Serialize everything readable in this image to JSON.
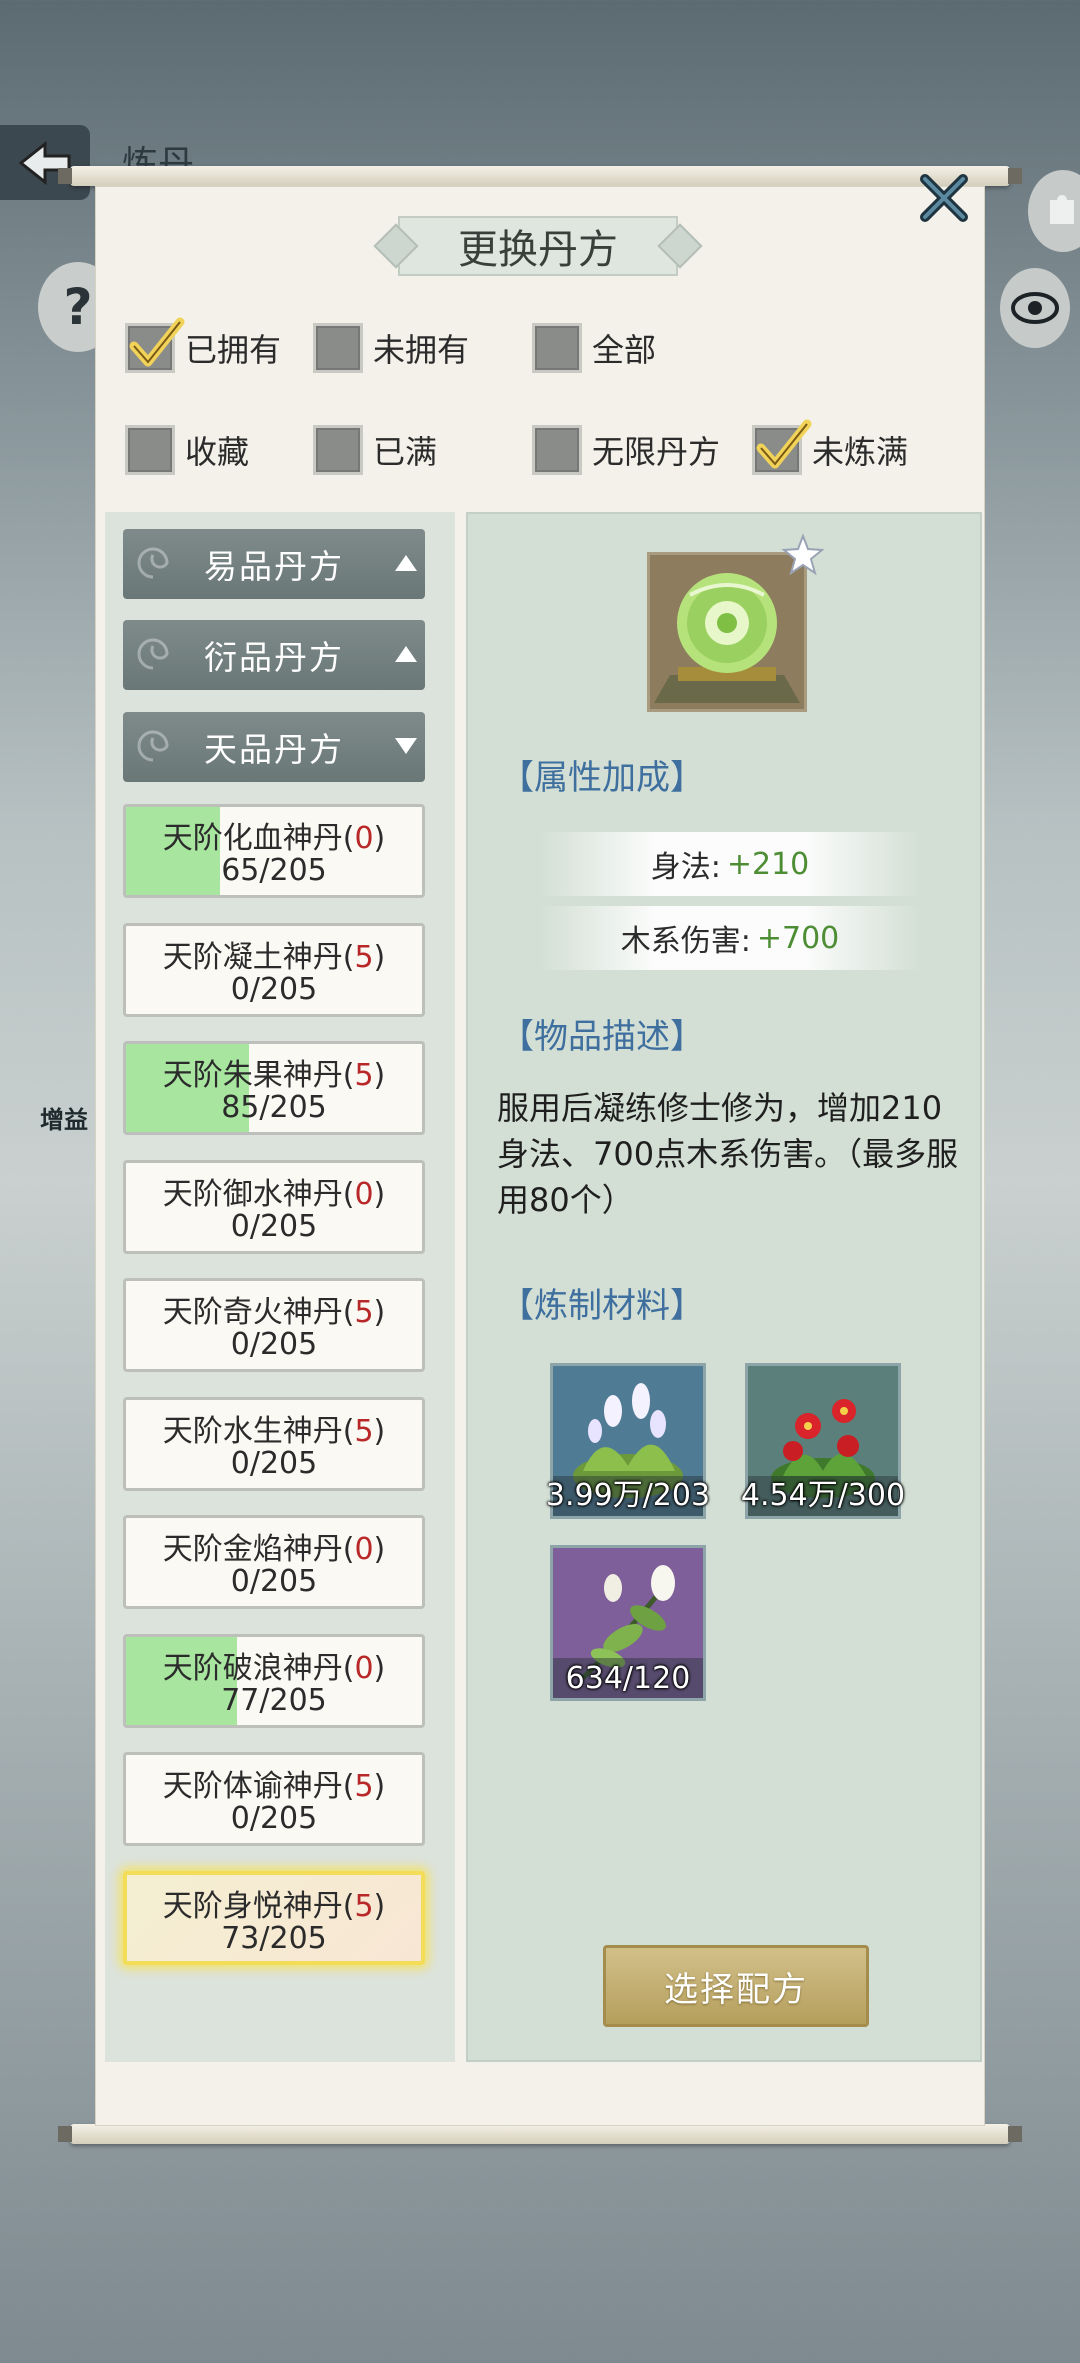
{
  "background": {
    "page_title": "炼丹",
    "side_badge": "增益"
  },
  "dialog": {
    "title": "更换丹方",
    "filters": [
      {
        "label": "已拥有",
        "checked": true
      },
      {
        "label": "未拥有",
        "checked": false
      },
      {
        "label": "全部",
        "checked": false
      },
      {
        "label": "收藏",
        "checked": false
      },
      {
        "label": "已满",
        "checked": false
      },
      {
        "label": "无限丹方",
        "checked": false
      },
      {
        "label": "未炼满",
        "checked": true
      }
    ],
    "categories": [
      {
        "label": "易品丹方",
        "expanded": false
      },
      {
        "label": "衍品丹方",
        "expanded": false
      },
      {
        "label": "天品丹方",
        "expanded": true
      }
    ],
    "recipes": [
      {
        "name": "天阶化血神丹",
        "count": "0",
        "progress": "65/205",
        "fraction": 0.317
      },
      {
        "name": "天阶凝土神丹",
        "count": "5",
        "progress": "0/205",
        "fraction": 0
      },
      {
        "name": "天阶朱果神丹",
        "count": "5",
        "progress": "85/205",
        "fraction": 0.415
      },
      {
        "name": "天阶御水神丹",
        "count": "0",
        "progress": "0/205",
        "fraction": 0
      },
      {
        "name": "天阶奇火神丹",
        "count": "5",
        "progress": "0/205",
        "fraction": 0
      },
      {
        "name": "天阶水生神丹",
        "count": "5",
        "progress": "0/205",
        "fraction": 0
      },
      {
        "name": "天阶金焰神丹",
        "count": "0",
        "progress": "0/205",
        "fraction": 0
      },
      {
        "name": "天阶破浪神丹",
        "count": "0",
        "progress": "77/205",
        "fraction": 0.376
      },
      {
        "name": "天阶体谕神丹",
        "count": "5",
        "progress": "0/205",
        "fraction": 0
      },
      {
        "name": "天阶身悦神丹",
        "count": "5",
        "progress": "73/205",
        "fraction": 0.356,
        "selected": true
      }
    ],
    "detail": {
      "attr_title": "【属性加成】",
      "stats": [
        {
          "label": "身法:",
          "value": "+210"
        },
        {
          "label": "木系伤害:",
          "value": "+700"
        }
      ],
      "desc_title": "【物品描述】",
      "description": "服用后凝练修士修为，增加210身法、700点木系伤害。（最多服用80个）",
      "materials_title": "【炼制材料】",
      "materials": [
        {
          "count": "3.99万/203",
          "icon": "white-flower-herb-icon"
        },
        {
          "count": "4.54万/300",
          "icon": "red-flower-herb-icon"
        },
        {
          "count": "634/120",
          "icon": "white-bud-herb-icon"
        }
      ],
      "select_button": "选择配方"
    }
  },
  "colors": {
    "accent_blue": "#3f6f9e",
    "stat_green": "#4d8e34",
    "count_red": "#b82828",
    "progress_green": "#a8e6a0",
    "button_gold": "#c2ae70"
  }
}
